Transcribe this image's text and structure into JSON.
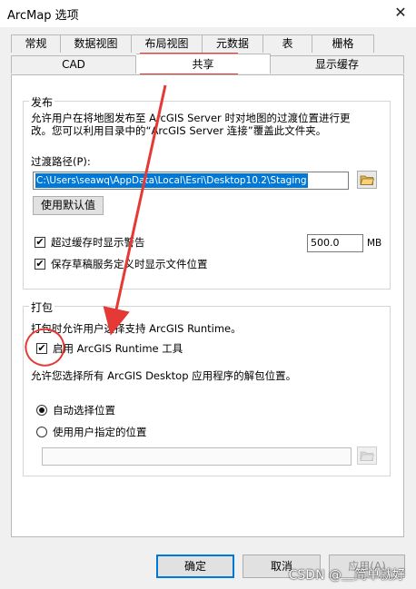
{
  "window": {
    "title": "ArcMap 选项",
    "close_glyph": "✕"
  },
  "tabs_row1": [
    "常规",
    "数据视图",
    "布局视图",
    "元数据",
    "表",
    "栅格"
  ],
  "tabs_row2": [
    "CAD",
    "共享",
    "显示缓存"
  ],
  "publish": {
    "title": "发布",
    "desc_line1": "允许用户在将地图发布至 ArcGIS Server 时对地图的过渡位置进行更",
    "desc_line2": "改。您可以利用目录中的“ArcGIS Server 连接”覆盖此文件夹。",
    "path_label": "过渡路径(P):",
    "path_value": "C:\\Users\\seawq\\AppData\\Local\\Esri\\Desktop10.2\\Staging",
    "default_button": "使用默认值",
    "warn_label": "超过缓存时显示警告",
    "warn_value": "500.0",
    "warn_unit": "MB",
    "show_location_label": "保存草稿服务定义时显示文件位置"
  },
  "package": {
    "title": "打包",
    "desc": "打包时允许用户选择支持 ArcGIS Runtime。",
    "enable_runtime_label": "启用 ArcGIS Runtime 工具",
    "unpack_desc": "允许您选择所有 ArcGIS Desktop 应用程序的解包位置。",
    "auto_label": "自动选择位置",
    "user_label": "使用用户指定的位置",
    "user_path_value": ""
  },
  "footer": {
    "ok": "确定",
    "cancel": "取消",
    "apply": "应用(A)"
  },
  "watermark": "CSDN @＿简单就好",
  "colors": {
    "annotation": "#e53935",
    "selection": "#0078d7",
    "checkmark": "#111111"
  },
  "icons": [
    "close-icon",
    "folder-icon",
    "check-icon",
    "annotation-arrow",
    "annotation-circle"
  ]
}
